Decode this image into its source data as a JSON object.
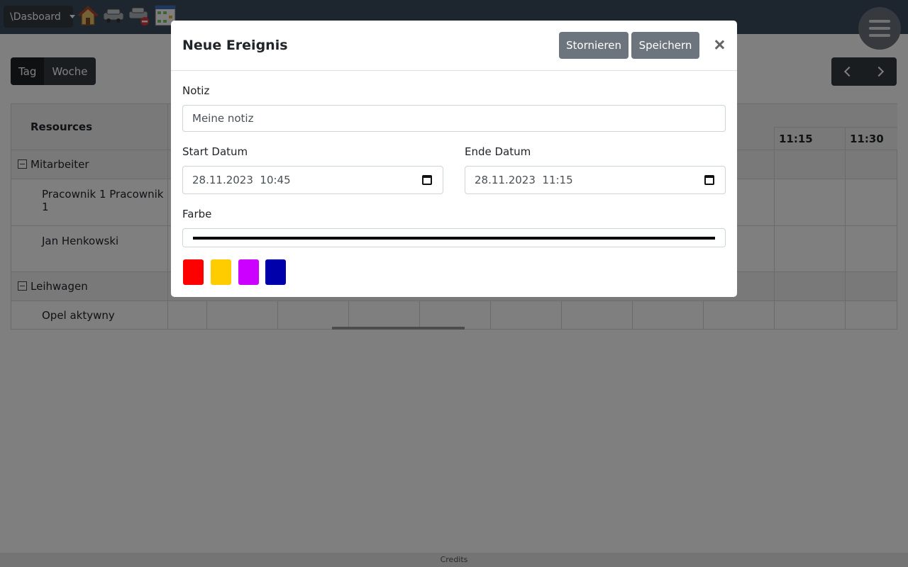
{
  "topbar": {
    "dashboard_label": "\\Dasboard",
    "icons": [
      "home-icon",
      "cars-icon",
      "car-blocked-icon",
      "calendar-icon"
    ]
  },
  "view_toggle": {
    "day": "Tag",
    "week": "Woche",
    "active": "Tag"
  },
  "scheduler": {
    "resources_header": "Resources",
    "time_columns": [
      "11:15",
      "11:30"
    ],
    "groups": [
      {
        "name": "Mitarbeiter",
        "resources": [
          "Pracownik 1 Pracownik 1",
          "Jan Henkowski"
        ]
      },
      {
        "name": "Leihwagen",
        "resources": [
          "Opel aktywny"
        ]
      }
    ]
  },
  "modal": {
    "title": "Neue Ereignis",
    "cancel_label": "Stornieren",
    "save_label": "Speichern",
    "note_label": "Notiz",
    "note_value": "Meine notiz",
    "start_label": "Start Datum",
    "start_value": "28.11.2023  10:45",
    "end_label": "Ende Datum",
    "end_value": "28.11.2023  11:15",
    "color_label": "Farbe",
    "color_value": "#000000",
    "swatches": [
      "#ff0000",
      "#ffcc00",
      "#cc00ff",
      "#0000aa"
    ]
  },
  "footer": {
    "credits": "Credits"
  },
  "colors": {
    "topbar": "#3a4a5c",
    "dark_button": "#343a40",
    "grey_button": "#6c757d"
  }
}
